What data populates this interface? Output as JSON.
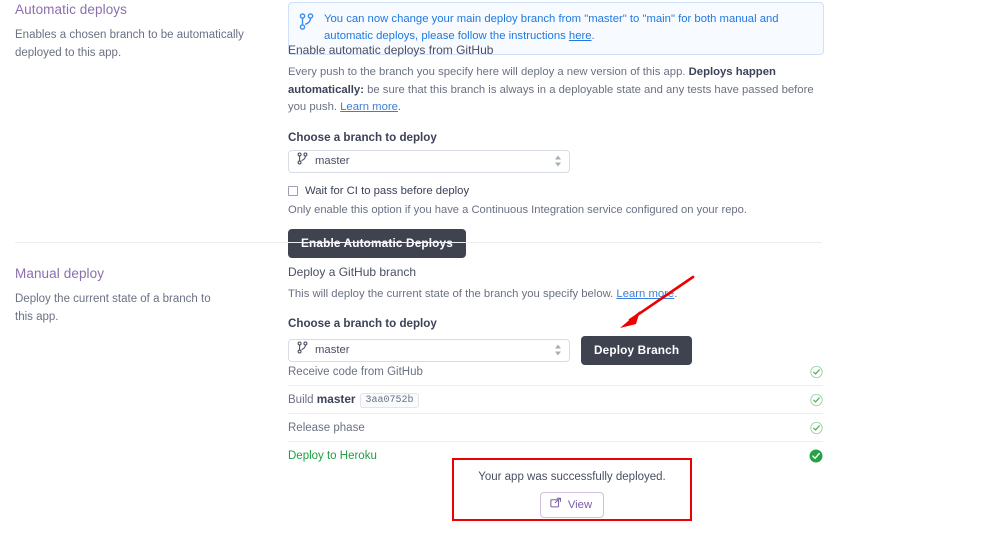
{
  "banner": {
    "icon": "git-branch-icon",
    "text_before": "You can now change your main deploy branch from \"master\" to \"main\" for both manual and automatic deploys, please follow the instructions ",
    "link_label": "here",
    "text_after": ".",
    "link_color": "#1f7ae0",
    "bg": "#f7faff",
    "border": "#cfe0fb"
  },
  "automatic_deploys": {
    "title": "Automatic deploys",
    "description": "Enables a chosen branch to be automatically deployed to this app.",
    "heading": "Enable automatic deploys from GitHub",
    "paragraph_part1": "Every push to the branch you specify here will deploy a new version of this app. ",
    "paragraph_bold": "Deploys happen automatically:",
    "paragraph_part2": " be sure that this branch is always in a deployable state and any tests have passed before you push. ",
    "paragraph_link": "Learn more",
    "paragraph_end": ".",
    "branch_label": "Choose a branch to deploy",
    "branch_value": "master",
    "branch_icon": "git-branch-icon",
    "checkbox_label": "Wait for CI to pass before deploy",
    "checkbox_checked": false,
    "checkbox_hint": "Only enable this option if you have a Continuous Integration service configured on your repo.",
    "button_label": "Enable Automatic Deploys"
  },
  "manual_deploy": {
    "title": "Manual deploy",
    "description": "Deploy the current state of a branch to this app.",
    "heading": "Deploy a GitHub branch",
    "paragraph_part1": "This will deploy the current state of the branch you specify below. ",
    "paragraph_link": "Learn more",
    "paragraph_end": ".",
    "branch_label": "Choose a branch to deploy",
    "branch_value": "master",
    "branch_icon": "git-branch-icon",
    "deploy_button_label": "Deploy Branch"
  },
  "steps": [
    {
      "label": "Receive code from GitHub",
      "status": "done",
      "icon": "check-circle-outline-icon",
      "active": false
    },
    {
      "label_prefix": "Build ",
      "label_bold": "master",
      "hash": "3aa0752b",
      "status": "done",
      "icon": "check-circle-outline-icon",
      "active": false
    },
    {
      "label": "Release phase",
      "status": "done",
      "icon": "check-circle-outline-icon",
      "active": false
    },
    {
      "label": "Deploy to Heroku",
      "status": "done",
      "icon": "check-circle-filled-icon",
      "active": true
    }
  ],
  "success": {
    "message": "Your app was successfully deployed.",
    "view_button_label": "View",
    "view_button_icon": "external-link-icon",
    "highlight_color": "#ef0000"
  },
  "annotation": {
    "arrow_icon": "red-arrow-pointing-to-deploy-branch",
    "color": "#ee0000"
  }
}
